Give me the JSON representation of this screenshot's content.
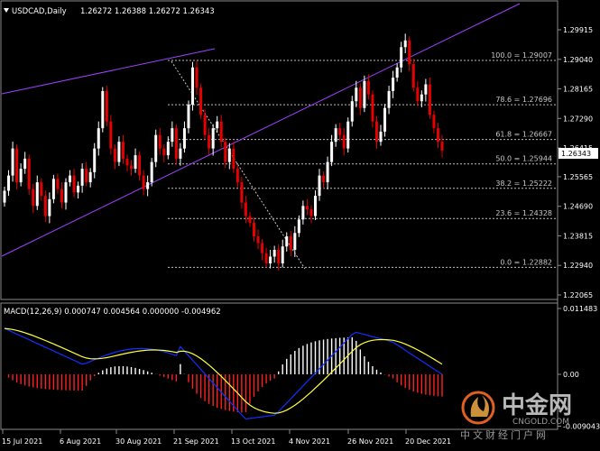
{
  "header": {
    "symbol": "USDCAD,Daily",
    "ohlc": "1.26272 1.26388 1.26272 1.26343"
  },
  "current_price": "1.26343",
  "price_axis": [
    "1.29915",
    "1.29040",
    "1.28165",
    "1.27290",
    "1.26415",
    "1.25565",
    "1.24690",
    "1.23815",
    "1.22940",
    "1.22065"
  ],
  "macd_axis": [
    "0.011483",
    "0.00",
    "-0.009043"
  ],
  "macd_header": "MACD(12,26,9) 0.000747 0.004564 0.000000 -0.004962",
  "time_axis": [
    "15 Jul 2021",
    "6 Aug 2021",
    "30 Aug 2021",
    "21 Sep 2021",
    "13 Oct 2021",
    "4 Nov 2021",
    "26 Nov 2021",
    "20 Dec 2021"
  ],
  "fibonacci": [
    {
      "label": "100.0 = 1.29007",
      "value": 1.29007
    },
    {
      "label": "78.6 = 1.27696",
      "value": 1.27696
    },
    {
      "label": "61.8 = 1.26667",
      "value": 1.26667
    },
    {
      "label": "50.0 = 1.25944",
      "value": 1.25944
    },
    {
      "label": "38.2 = 1.25222",
      "value": 1.25222
    },
    {
      "label": "23.6 = 1.24328",
      "value": 1.24328
    },
    {
      "label": "0.0 = 1.22882",
      "value": 1.22882
    }
  ],
  "watermark": {
    "brand": "中金网",
    "url": "CNGOLD.COM",
    "tagline": "中文财经门户网"
  },
  "colors": {
    "background": "#000000",
    "bull": "#ffffff",
    "bear": "#e60000",
    "channel": "#a040ff",
    "macd_line": "#1030ff",
    "signal_line": "#ffff40",
    "hist_pos": "#ffffff",
    "hist_neg": "#ff2020"
  }
}
